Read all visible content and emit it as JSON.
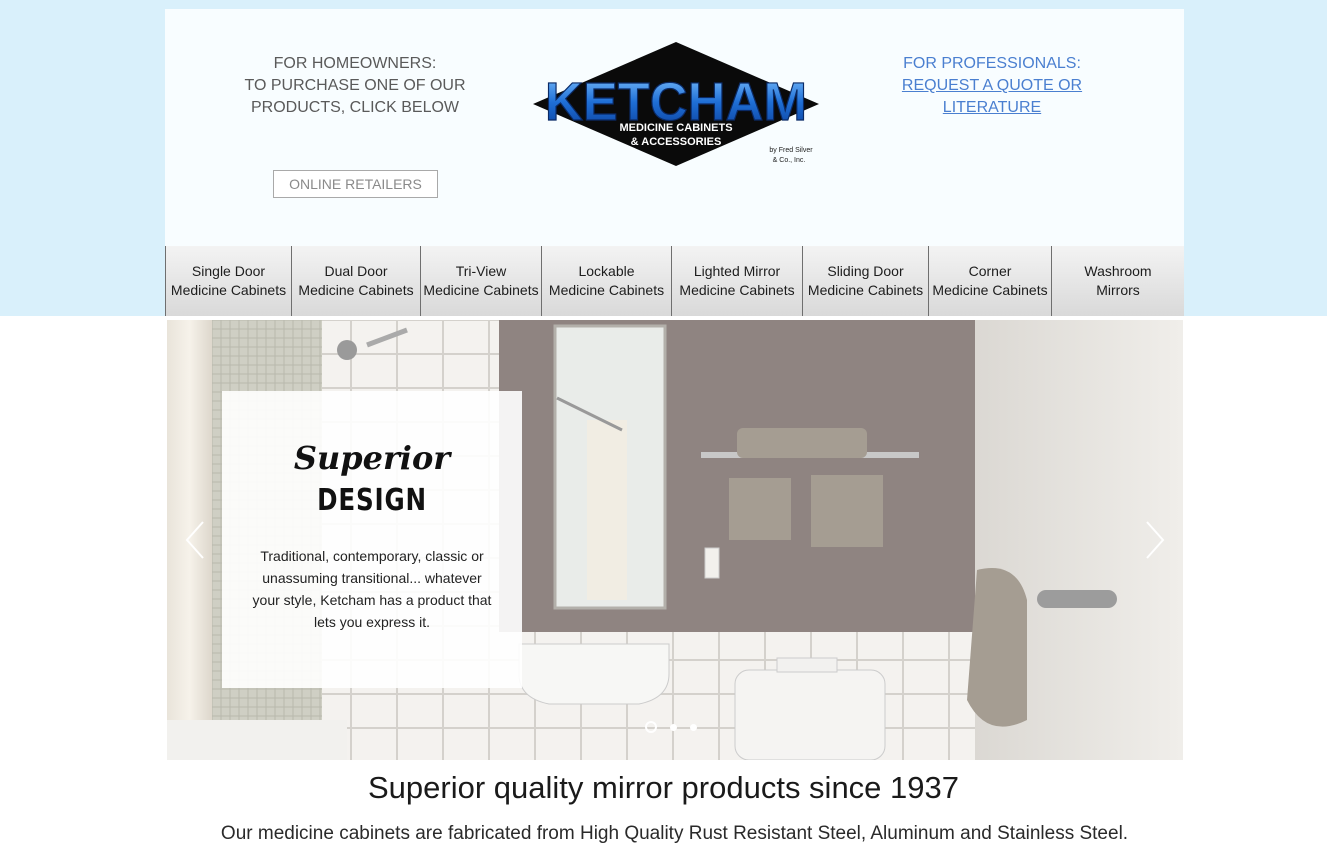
{
  "header": {
    "homeowners_line1": "FOR HOMEOWNERS:",
    "homeowners_line2": "TO PURCHASE ONE OF OUR",
    "homeowners_line3": "PRODUCTS, CLICK BELOW",
    "online_retailers_label": "ONLINE RETAILERS",
    "professionals_line1": "FOR PROFESSIONALS:",
    "professionals_link_line1": "REQUEST A QUOTE OR",
    "professionals_link_line2": "LITERATURE"
  },
  "logo": {
    "brand": "KETCHAM",
    "tagline1": "MEDICINE CABINETS",
    "tagline2": "& ACCESSORIES",
    "byline1": "by Fred Silver",
    "byline2": "& Co., Inc."
  },
  "nav": {
    "items": [
      {
        "line1": "Single Door",
        "line2": "Medicine Cabinets"
      },
      {
        "line1": "Dual Door",
        "line2": "Medicine Cabinets"
      },
      {
        "line1": "Tri-View",
        "line2": "Medicine Cabinets"
      },
      {
        "line1": "Lockable",
        "line2": "Medicine Cabinets"
      },
      {
        "line1": "Lighted Mirror",
        "line2": "Medicine Cabinets"
      },
      {
        "line1": "Sliding Door",
        "line2": "Medicine Cabinets"
      },
      {
        "line1": "Corner",
        "line2": "Medicine Cabinets"
      },
      {
        "line1": "Washroom",
        "line2": "Mirrors"
      }
    ]
  },
  "slide": {
    "script_word": "Superior",
    "title": "DESIGN",
    "body": "Traditional, contemporary, classic or unassuming transitional... whatever your style, Ketcham has a product that lets you express it.",
    "slide_count": 3,
    "active_slide": 1
  },
  "main": {
    "tagline": "Superior quality mirror products since 1937",
    "subline": "Our medicine cabinets are fabricated from High Quality Rust Resistant Steel, Aluminum and Stainless Steel."
  },
  "colors": {
    "top_band": "#d9f0fb",
    "link_blue": "#4a7fd0",
    "logo_blue": "#1f6fd6"
  }
}
